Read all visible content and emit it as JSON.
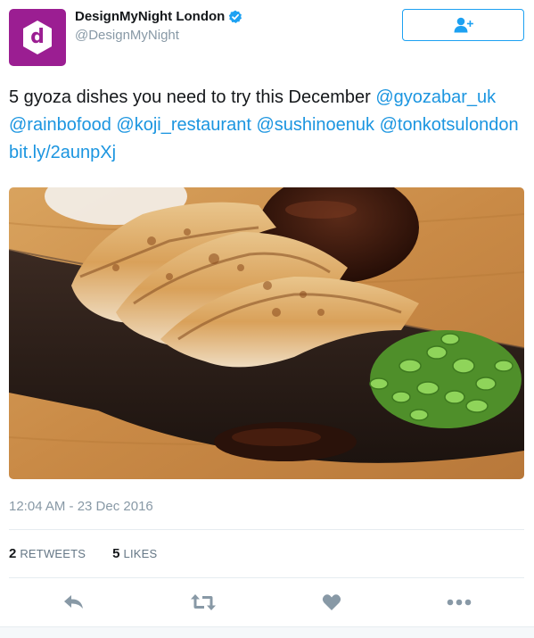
{
  "author": {
    "name": "DesignMyNight London",
    "handle": "@DesignMyNight",
    "avatar_letter": "d",
    "avatar_color": "#9b1e92",
    "verified_icon": "verified-badge-icon"
  },
  "follow_button": {
    "icon": "add-user-icon",
    "accent_color": "#1da1f2"
  },
  "tweet": {
    "text_prefix": "5 gyoza dishes you need to try this December ",
    "mentions": [
      "@gyozabar_uk",
      "@rainbofood",
      "@koji_restaurant",
      "@sushinoenuk",
      "@tonkotsulondon"
    ],
    "link": "bit.ly/2aunpXj",
    "link_color": "#1b95e0"
  },
  "media": {
    "description_icon": "photo-gyoza"
  },
  "timestamp": "12:04 AM - 23 Dec 2016",
  "stats": {
    "retweets_count": "2",
    "retweets_label": "RETWEETS",
    "likes_count": "5",
    "likes_label": "LIKES"
  },
  "actions": {
    "reply_icon": "reply-icon",
    "retweet_icon": "retweet-icon",
    "like_icon": "heart-icon",
    "more_icon": "more-icon",
    "icon_color": "#8899a6"
  }
}
